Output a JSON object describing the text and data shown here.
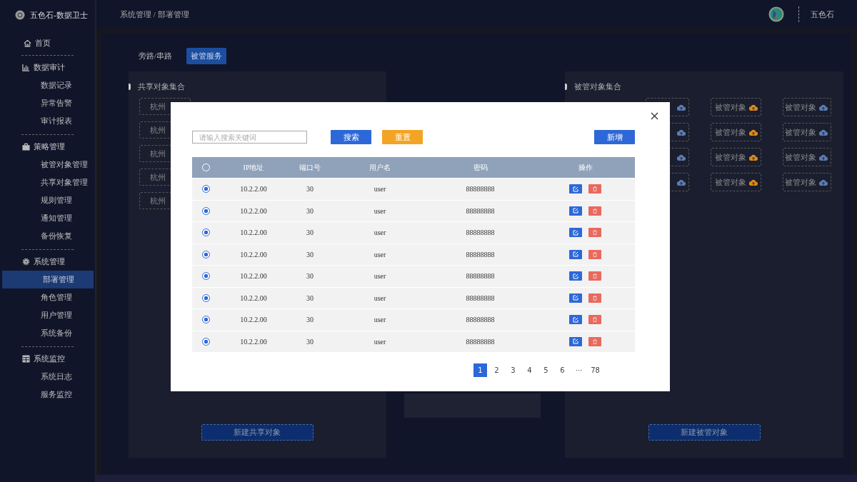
{
  "brand": {
    "title": "五色石-数据卫士"
  },
  "breadcrumb": "系统管理 / 部署管理",
  "user": {
    "name": "五色石"
  },
  "sidebar": {
    "groups": [
      {
        "kind": "home",
        "label": "首页"
      },
      {
        "kind": "chart",
        "label": "数据审计",
        "items": [
          {
            "label": "数据记录",
            "selected": false
          },
          {
            "label": "异常告警",
            "selected": false
          },
          {
            "label": "审计报表",
            "selected": false
          }
        ]
      },
      {
        "kind": "bag",
        "label": "策略管理",
        "items": [
          {
            "label": "被管对象管理",
            "selected": false
          },
          {
            "label": "共享对象管理",
            "selected": false
          },
          {
            "label": "规则管理",
            "selected": false
          },
          {
            "label": "通知管理",
            "selected": false
          },
          {
            "label": "备份恢复",
            "selected": false
          }
        ]
      },
      {
        "kind": "gear",
        "label": "系统管理",
        "items": [
          {
            "label": "部署管理",
            "selected": true
          },
          {
            "label": "角色管理",
            "selected": false
          },
          {
            "label": "用户管理",
            "selected": false
          },
          {
            "label": "系统备份",
            "selected": false
          }
        ]
      },
      {
        "kind": "table",
        "label": "系统监控",
        "items": [
          {
            "label": "系统日志",
            "selected": false
          },
          {
            "label": "服务监控",
            "selected": false
          }
        ]
      }
    ]
  },
  "tabs": [
    {
      "label": "旁路/串路",
      "selected": false
    },
    {
      "label": "被管服务",
      "selected": true
    }
  ],
  "shared_panel": {
    "title": "共享对象集合",
    "tiles": [
      "杭州",
      "杭州",
      "杭州",
      "杭州",
      "杭州"
    ],
    "button": "新建共享对象"
  },
  "managed_panel": {
    "title": "被管对象集合",
    "tiles": [
      {
        "color": "#5b7bb0"
      },
      {
        "label": "被管对象",
        "color": "#d88a1c"
      },
      {
        "label": "被管对象",
        "color": "#5b7bb0"
      },
      {
        "color": "#5b7bb0"
      },
      {
        "label": "被管对象",
        "color": "#d88a1c"
      },
      {
        "label": "被管对象",
        "color": "#5b7bb0"
      },
      {
        "color": "#5b7bb0"
      },
      {
        "label": "被管对象",
        "color": "#d88a1c"
      },
      {
        "label": "被管对象",
        "color": "#5b7bb0"
      },
      {
        "color": "#5b7bb0"
      },
      {
        "label": "被管对象",
        "color": "#d88a1c"
      },
      {
        "label": "被管对象",
        "color": "#5b7bb0"
      }
    ],
    "button": "新建被管对象"
  },
  "dialog": {
    "search": {
      "placeholder": "请输入搜索关键词"
    },
    "buttons": [
      {
        "kind": "primary",
        "label": "搜索"
      },
      {
        "kind": "warning",
        "label": "重置"
      }
    ],
    "add_button": "新增",
    "table": {
      "header_checked": false,
      "columns": [
        "IP地址",
        "端口号",
        "用户名",
        "密码",
        "操作"
      ],
      "rows": [
        {
          "checked": true,
          "ip": "10.2.2.00",
          "port": "30",
          "user": "user",
          "password": "88888888"
        },
        {
          "checked": true,
          "ip": "10.2.2.00",
          "port": "30",
          "user": "user",
          "password": "88888888"
        },
        {
          "checked": true,
          "ip": "10.2.2.00",
          "port": "30",
          "user": "user",
          "password": "88888888"
        },
        {
          "checked": true,
          "ip": "10.2.2.00",
          "port": "30",
          "user": "user",
          "password": "88888888"
        },
        {
          "checked": true,
          "ip": "10.2.2.00",
          "port": "30",
          "user": "user",
          "password": "88888888"
        },
        {
          "checked": true,
          "ip": "10.2.2.00",
          "port": "30",
          "user": "user",
          "password": "88888888"
        },
        {
          "checked": true,
          "ip": "10.2.2.00",
          "port": "30",
          "user": "user",
          "password": "88888888"
        },
        {
          "checked": true,
          "ip": "10.2.2.00",
          "port": "30",
          "user": "user",
          "password": "88888888"
        }
      ]
    },
    "pagination": [
      {
        "label": "1",
        "selected": true
      },
      {
        "label": "2",
        "selected": false
      },
      {
        "label": "3",
        "selected": false
      },
      {
        "label": "4",
        "selected": false
      },
      {
        "label": "5",
        "selected": false
      },
      {
        "label": "6",
        "selected": false
      },
      {
        "label": "···",
        "selected": false
      },
      {
        "label": "78",
        "selected": false
      }
    ]
  }
}
